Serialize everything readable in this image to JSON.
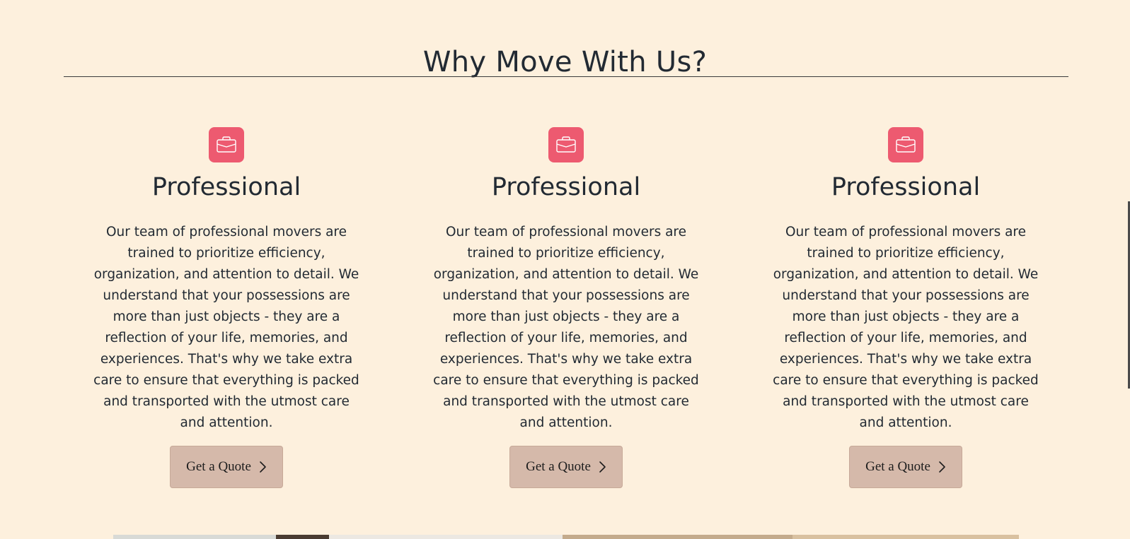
{
  "section": {
    "title": "Why Move With Us?"
  },
  "colors": {
    "background": "#fdf0dd",
    "icon_background": "#ed5a70",
    "button_background": "#d5b9aa",
    "text": "#222a33"
  },
  "features": [
    {
      "icon": "briefcase-icon",
      "heading": "Professional",
      "text": "Our team of professional movers are trained to prioritize efficiency, organization, and attention to detail. We understand that your possessions are more than just objects - they are a reflection of your life, memories, and experiences. That's why we take extra care to ensure that everything is packed and transported with the utmost care and attention.",
      "button_label": "Get a Quote",
      "button_icon": "chevron-right-icon"
    },
    {
      "icon": "briefcase-icon",
      "heading": "Professional",
      "text": "Our team of professional movers are trained to prioritize efficiency, organization, and attention to detail. We understand that your possessions are more than just objects - they are a reflection of your life, memories, and experiences. That's why we take extra care to ensure that everything is packed and transported with the utmost care and attention.",
      "button_label": "Get a Quote",
      "button_icon": "chevron-right-icon"
    },
    {
      "icon": "briefcase-icon",
      "heading": "Professional",
      "text": "Our team of professional movers are trained to prioritize efficiency, organization, and attention to detail. We understand that your possessions are more than just objects - they are a reflection of your life, memories, and experiences. That's why we take extra care to ensure that everything is packed and transported with the utmost care and attention.",
      "button_label": "Get a Quote",
      "button_icon": "chevron-right-icon"
    }
  ]
}
